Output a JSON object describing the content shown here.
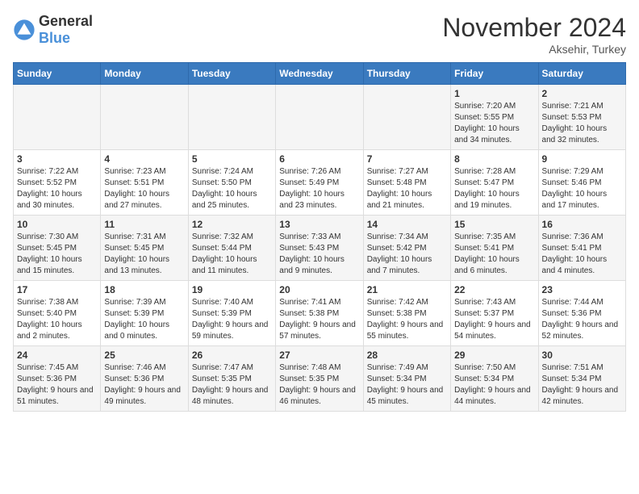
{
  "header": {
    "logo_general": "General",
    "logo_blue": "Blue",
    "month_year": "November 2024",
    "location": "Aksehir, Turkey"
  },
  "weekdays": [
    "Sunday",
    "Monday",
    "Tuesday",
    "Wednesday",
    "Thursday",
    "Friday",
    "Saturday"
  ],
  "weeks": [
    [
      {
        "day": "",
        "info": ""
      },
      {
        "day": "",
        "info": ""
      },
      {
        "day": "",
        "info": ""
      },
      {
        "day": "",
        "info": ""
      },
      {
        "day": "",
        "info": ""
      },
      {
        "day": "1",
        "info": "Sunrise: 7:20 AM\nSunset: 5:55 PM\nDaylight: 10 hours and 34 minutes."
      },
      {
        "day": "2",
        "info": "Sunrise: 7:21 AM\nSunset: 5:53 PM\nDaylight: 10 hours and 32 minutes."
      }
    ],
    [
      {
        "day": "3",
        "info": "Sunrise: 7:22 AM\nSunset: 5:52 PM\nDaylight: 10 hours and 30 minutes."
      },
      {
        "day": "4",
        "info": "Sunrise: 7:23 AM\nSunset: 5:51 PM\nDaylight: 10 hours and 27 minutes."
      },
      {
        "day": "5",
        "info": "Sunrise: 7:24 AM\nSunset: 5:50 PM\nDaylight: 10 hours and 25 minutes."
      },
      {
        "day": "6",
        "info": "Sunrise: 7:26 AM\nSunset: 5:49 PM\nDaylight: 10 hours and 23 minutes."
      },
      {
        "day": "7",
        "info": "Sunrise: 7:27 AM\nSunset: 5:48 PM\nDaylight: 10 hours and 21 minutes."
      },
      {
        "day": "8",
        "info": "Sunrise: 7:28 AM\nSunset: 5:47 PM\nDaylight: 10 hours and 19 minutes."
      },
      {
        "day": "9",
        "info": "Sunrise: 7:29 AM\nSunset: 5:46 PM\nDaylight: 10 hours and 17 minutes."
      }
    ],
    [
      {
        "day": "10",
        "info": "Sunrise: 7:30 AM\nSunset: 5:45 PM\nDaylight: 10 hours and 15 minutes."
      },
      {
        "day": "11",
        "info": "Sunrise: 7:31 AM\nSunset: 5:45 PM\nDaylight: 10 hours and 13 minutes."
      },
      {
        "day": "12",
        "info": "Sunrise: 7:32 AM\nSunset: 5:44 PM\nDaylight: 10 hours and 11 minutes."
      },
      {
        "day": "13",
        "info": "Sunrise: 7:33 AM\nSunset: 5:43 PM\nDaylight: 10 hours and 9 minutes."
      },
      {
        "day": "14",
        "info": "Sunrise: 7:34 AM\nSunset: 5:42 PM\nDaylight: 10 hours and 7 minutes."
      },
      {
        "day": "15",
        "info": "Sunrise: 7:35 AM\nSunset: 5:41 PM\nDaylight: 10 hours and 6 minutes."
      },
      {
        "day": "16",
        "info": "Sunrise: 7:36 AM\nSunset: 5:41 PM\nDaylight: 10 hours and 4 minutes."
      }
    ],
    [
      {
        "day": "17",
        "info": "Sunrise: 7:38 AM\nSunset: 5:40 PM\nDaylight: 10 hours and 2 minutes."
      },
      {
        "day": "18",
        "info": "Sunrise: 7:39 AM\nSunset: 5:39 PM\nDaylight: 10 hours and 0 minutes."
      },
      {
        "day": "19",
        "info": "Sunrise: 7:40 AM\nSunset: 5:39 PM\nDaylight: 9 hours and 59 minutes."
      },
      {
        "day": "20",
        "info": "Sunrise: 7:41 AM\nSunset: 5:38 PM\nDaylight: 9 hours and 57 minutes."
      },
      {
        "day": "21",
        "info": "Sunrise: 7:42 AM\nSunset: 5:38 PM\nDaylight: 9 hours and 55 minutes."
      },
      {
        "day": "22",
        "info": "Sunrise: 7:43 AM\nSunset: 5:37 PM\nDaylight: 9 hours and 54 minutes."
      },
      {
        "day": "23",
        "info": "Sunrise: 7:44 AM\nSunset: 5:36 PM\nDaylight: 9 hours and 52 minutes."
      }
    ],
    [
      {
        "day": "24",
        "info": "Sunrise: 7:45 AM\nSunset: 5:36 PM\nDaylight: 9 hours and 51 minutes."
      },
      {
        "day": "25",
        "info": "Sunrise: 7:46 AM\nSunset: 5:36 PM\nDaylight: 9 hours and 49 minutes."
      },
      {
        "day": "26",
        "info": "Sunrise: 7:47 AM\nSunset: 5:35 PM\nDaylight: 9 hours and 48 minutes."
      },
      {
        "day": "27",
        "info": "Sunrise: 7:48 AM\nSunset: 5:35 PM\nDaylight: 9 hours and 46 minutes."
      },
      {
        "day": "28",
        "info": "Sunrise: 7:49 AM\nSunset: 5:34 PM\nDaylight: 9 hours and 45 minutes."
      },
      {
        "day": "29",
        "info": "Sunrise: 7:50 AM\nSunset: 5:34 PM\nDaylight: 9 hours and 44 minutes."
      },
      {
        "day": "30",
        "info": "Sunrise: 7:51 AM\nSunset: 5:34 PM\nDaylight: 9 hours and 42 minutes."
      }
    ]
  ]
}
